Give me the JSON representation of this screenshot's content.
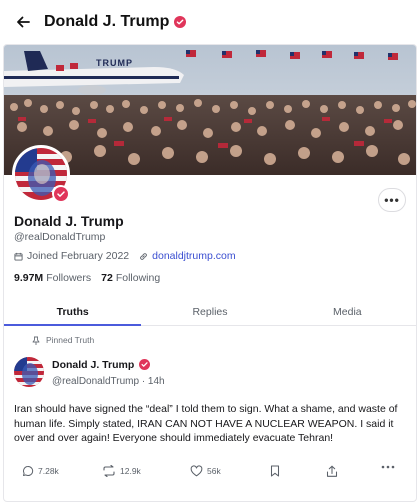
{
  "header": {
    "title": "Donald J. Trump"
  },
  "profile": {
    "name": "Donald J. Trump",
    "handle": "@realDonaldTrump",
    "joined": "Joined February 2022",
    "website": "donaldjtrump.com",
    "followers_count": "9.97M",
    "followers_label": "Followers",
    "following_count": "72",
    "following_label": "Following",
    "more_label": "•••"
  },
  "tabs": [
    {
      "label": "Truths",
      "active": true
    },
    {
      "label": "Replies",
      "active": false
    },
    {
      "label": "Media",
      "active": false
    }
  ],
  "post": {
    "pinned_label": "Pinned Truth",
    "author": "Donald J. Trump",
    "handle_time": "@realDonaldTrump · 14h",
    "text": "Iran should have signed the “deal” I told them to sign. What a shame, and waste of human life. Simply stated, IRAN CAN NOT HAVE A NUCLEAR WEAPON. I said it over and over again! Everyone should immediately evacuate Tehran!",
    "replies": "7.28k",
    "retruths": "12.9k",
    "likes": "56k"
  },
  "banner_text": "TRUMP",
  "colors": {
    "accent": "#4b5bdc",
    "verified": "#e0355a",
    "link": "#3b4fd1"
  },
  "icons": [
    "back-arrow-icon",
    "verified-badge-icon",
    "calendar-icon",
    "link-icon",
    "pin-icon",
    "reply-icon",
    "retruth-icon",
    "like-icon",
    "bookmark-icon",
    "share-icon",
    "more-icon"
  ]
}
